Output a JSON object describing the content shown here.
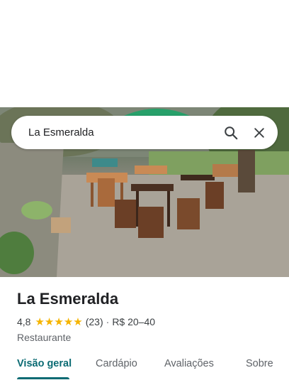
{
  "search": {
    "query": "La Esmeralda"
  },
  "place": {
    "name": "La Esmeralda",
    "rating": "4,8",
    "rating_value": 4.8,
    "review_count": "(23)",
    "separator": "·",
    "price_range": "R$ 20–40",
    "category": "Restaurante"
  },
  "tabs": [
    {
      "label": "Visão geral",
      "active": true
    },
    {
      "label": "Cardápio",
      "active": false
    },
    {
      "label": "Avaliações",
      "active": false
    },
    {
      "label": "Sobre",
      "active": false
    }
  ],
  "icons": {
    "search": "search-icon",
    "close": "close-icon",
    "star": "star-icon"
  },
  "colors": {
    "star": "#f5b400",
    "active_tab": "#0b6b73"
  }
}
